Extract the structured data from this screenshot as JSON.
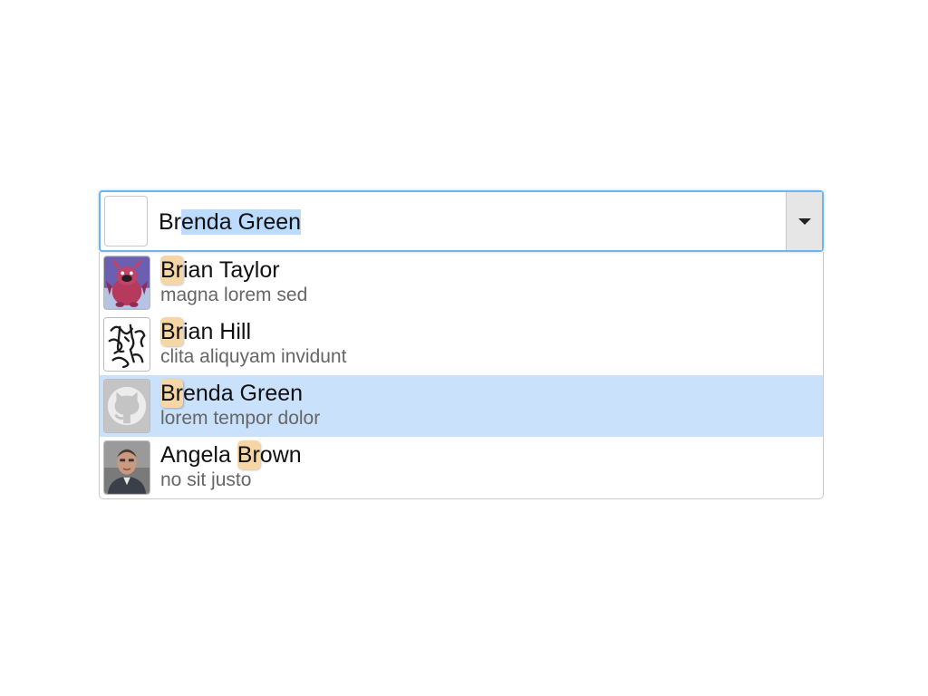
{
  "input": {
    "value_prefix": "Br",
    "value_selected": "enda Green"
  },
  "options": [
    {
      "match": "Br",
      "name_rest": "ian Taylor",
      "description": "magna lorem sed",
      "avatar_icon": "monster-avatar-icon"
    },
    {
      "match": "Br",
      "name_rest": "ian Hill",
      "description": "clita aliquyam invidunt",
      "avatar_icon": "sketch-avatar-icon"
    },
    {
      "match": "Br",
      "name_rest": "enda Green",
      "description": "lorem tempor dolor",
      "avatar_icon": "github-octocat-icon"
    },
    {
      "name_before": "Angela ",
      "match": "Br",
      "name_rest": "own",
      "description": "no sit justo",
      "avatar_icon": "person-photo-icon"
    }
  ],
  "active_option_index": 2,
  "colors": {
    "focus_border": "#6fb4ee",
    "active_row": "#cae1fc",
    "match_highlight": "#f6d6a5",
    "text_selection": "#bcdcff"
  }
}
